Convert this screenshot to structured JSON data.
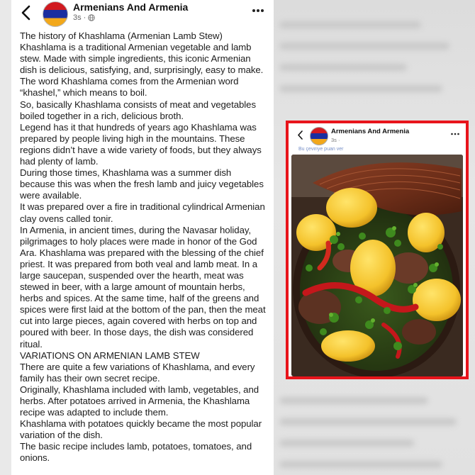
{
  "post": {
    "page_name": "Armenians And Armenia",
    "time": "3s",
    "time_separator": "·",
    "paragraphs": [
      "The history of Khashlama (Armenian Lamb Stew)",
      "Khashlama is a traditional Armenian vegetable and lamb stew. Made with simple ingredients, this iconic Armenian dish is delicious, satisfying, and, surprisingly, easy to make.",
      "The word Khashlama comes from the Armenian word “khashel,” which means to boil.",
      "So, basically Khashlama consists of meat and vegetables boiled together in a rich, delicious broth.",
      "Legend has it that hundreds of years ago Khashlama was prepared by people living high in the mountains. These regions didn’t have a wide variety of foods, but they always had plenty of lamb.",
      "During those times, Khashlama was a summer dish because this was when the fresh lamb and juicy vegetables were available.",
      "It was prepared over a fire in traditional cylindrical Armenian clay ovens called tonir.",
      "In Armenia, in ancient times, during the Navasar holiday, pilgrimages to holy places were made in honor of the God Ara. Khashlama was prepared with the blessing of the chief priest. It was prepared from both veal and lamb meat. In a large saucepan, suspended over the hearth, meat was stewed in beer, with a large amount of mountain herbs, herbs and spices. At the same time, half of the greens and spices were first laid at the bottom of the pan, then the meat cut into large pieces, again covered with herbs on top and poured with beer. In those days, the dish was considered ritual.",
      "VARIATIONS ON ARMENIAN LAMB STEW",
      "There are quite a few variations of Khashlama, and every family has their own secret recipe.",
      "Originally, Khashlama included with lamb, vegetables, and herbs. After potatoes arrived in Armenia, the Khashlama recipe was adapted to include them.",
      "Khashlama with potatoes quickly became the most popular variation of the dish.",
      "The basic recipe includes lamb, potatoes, tomatoes, and onions."
    ]
  },
  "card": {
    "page_name": "Armenians And Armenia",
    "time": "3s ·",
    "translate_text": "Bu çeviriye puan ver"
  },
  "colors": {
    "highlight_border": "#e8141b",
    "flag_red": "#d11a20",
    "flag_blue": "#1a2ea0",
    "flag_orange": "#f2a81b"
  },
  "icons": [
    "back-arrow-icon",
    "globe-icon",
    "more-options-icon"
  ]
}
